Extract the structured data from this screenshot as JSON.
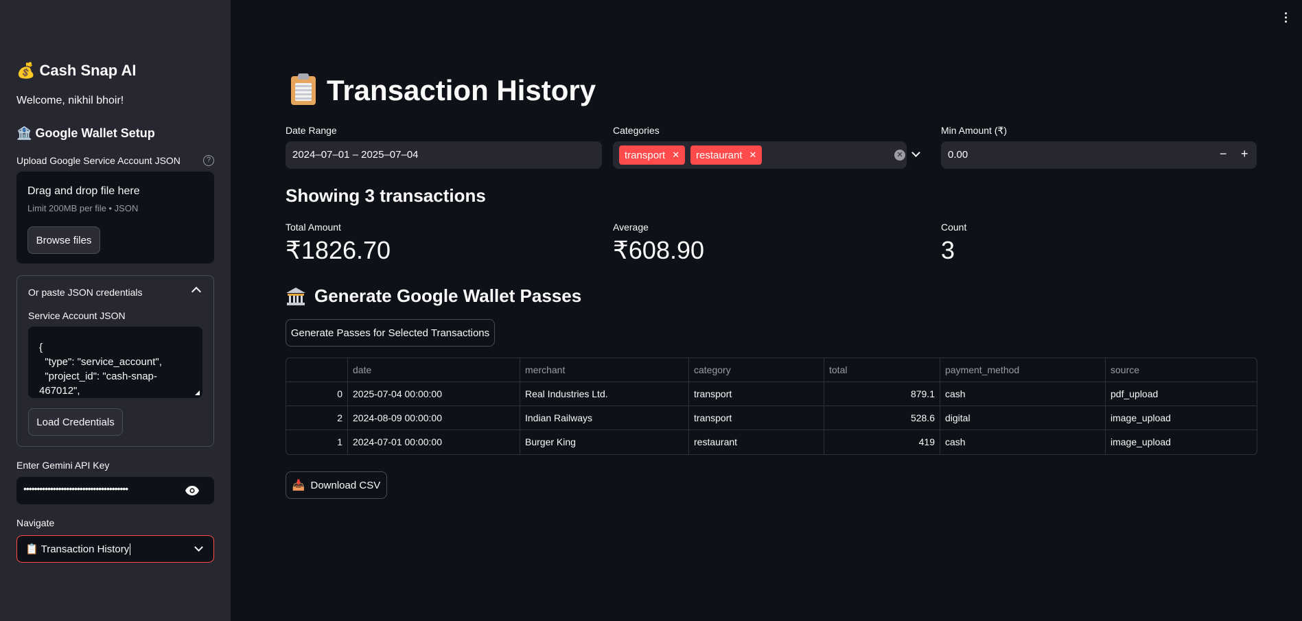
{
  "sidebar": {
    "title": "Cash Snap AI",
    "title_icon": "money-bag-icon",
    "welcome": "Welcome, nikhil bhoir!",
    "wallet_setup_title": "Google Wallet Setup",
    "upload_label": "Upload Google Service Account JSON",
    "dropzone_title": "Drag and drop file here",
    "dropzone_limit": "Limit 200MB per file • JSON",
    "browse_button": "Browse files",
    "expander_title": "Or paste JSON credentials",
    "service_account_label": "Service Account JSON",
    "service_account_value": "{\n  \"type\": \"service_account\",\n  \"project_id\": \"cash-snap-\n467012\",",
    "load_button": "Load Credentials",
    "gemini_label": "Enter Gemini API Key",
    "gemini_value": "•••••••••••••••••••••••••••••••••••••••",
    "navigate_label": "Navigate",
    "navigate_value": "Transaction History"
  },
  "main": {
    "title": "Transaction History",
    "filters": {
      "date_label": "Date Range",
      "date_value": "2024–07–01 – 2025–07–04",
      "categories_label": "Categories",
      "categories": [
        "transport",
        "restaurant"
      ],
      "min_amount_label": "Min Amount (₹)",
      "min_amount_value": "0.00",
      "minus": "−",
      "plus": "+"
    },
    "showing": "Showing 3 transactions",
    "metrics": [
      {
        "label": "Total Amount",
        "value": "₹1826.70"
      },
      {
        "label": "Average",
        "value": "₹608.90"
      },
      {
        "label": "Count",
        "value": "3"
      }
    ],
    "wallet_title": "Generate Google Wallet Passes",
    "generate_button": "Generate Passes for Selected Transactions",
    "table": {
      "columns": [
        "",
        "date",
        "merchant",
        "category",
        "total",
        "payment_method",
        "source"
      ],
      "rows": [
        [
          "0",
          "2025-07-04 00:00:00",
          "Real Industries Ltd.",
          "transport",
          "879.1",
          "cash",
          "pdf_upload"
        ],
        [
          "2",
          "2024-08-09 00:00:00",
          "Indian Railways",
          "transport",
          "528.6",
          "digital",
          "image_upload"
        ],
        [
          "1",
          "2024-07-01 00:00:00",
          "Burger King",
          "restaurant",
          "419",
          "cash",
          "image_upload"
        ]
      ]
    },
    "download_button": "Download CSV"
  },
  "colors": {
    "accent": "#ff4b4b",
    "background": "#0e1117",
    "sidebar": "#262730"
  }
}
